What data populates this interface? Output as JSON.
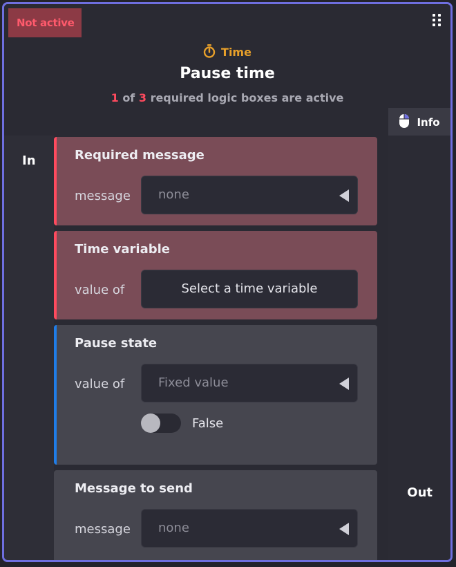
{
  "status_badge": "Not active",
  "header": {
    "category": "Time",
    "title": "Pause time",
    "active_count": "1",
    "of_text": "of",
    "required_count": "3",
    "subtitle_tail": "required logic boxes are active"
  },
  "info_tab": {
    "label": "Info"
  },
  "ports": {
    "in": "In",
    "out": "Out"
  },
  "blocks": [
    {
      "title": "Required message",
      "field_label": "message",
      "select_value": "none"
    },
    {
      "title": "Time variable",
      "field_label": "value of",
      "button_label": "Select a time variable"
    },
    {
      "title": "Pause state",
      "field_label": "value of",
      "select_value": "Fixed value",
      "toggle_label": "False",
      "toggle_on": false
    },
    {
      "title": "Message to send",
      "field_label": "message",
      "select_value": "none"
    }
  ],
  "colors": {
    "accent_required": "#ff4a5e",
    "accent_neutral": "#1f7de8",
    "category": "#e8a02a",
    "frame": "#6f6fe0"
  }
}
